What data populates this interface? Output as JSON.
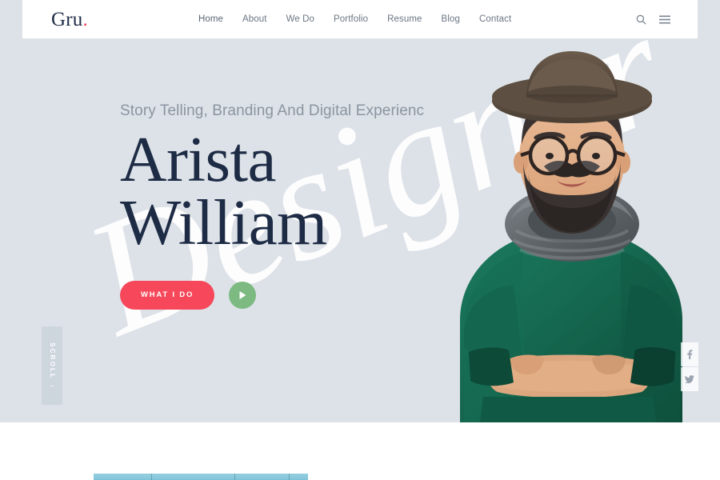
{
  "site": {
    "logo_text": "Gru",
    "logo_dot": ".",
    "accent_red": "#f6485a",
    "accent_green": "#7cba82",
    "text_dark": "#1d2b45",
    "page_bg": "#dde2e8"
  },
  "header": {
    "nav": [
      {
        "label": "Home"
      },
      {
        "label": "About"
      },
      {
        "label": "We Do"
      },
      {
        "label": "Portfolio"
      },
      {
        "label": "Resume"
      },
      {
        "label": "Blog"
      },
      {
        "label": "Contact"
      }
    ],
    "icons": [
      {
        "name": "search-icon"
      },
      {
        "name": "hamburger-menu-icon"
      }
    ]
  },
  "hero": {
    "watermark": "Designer",
    "subtitle": "Story Telling, Branding And Digital Experienc",
    "title_line1": "Arista",
    "title_line2": "William",
    "cta_label": "WHAT I DO",
    "play_label": "",
    "scroll_label": "SCROLL",
    "scroll_arrow": "↓",
    "photo_alt": "portrait-of-bearded-man-with-hat-and-glasses"
  },
  "social": [
    {
      "name": "facebook-icon",
      "label": "f"
    },
    {
      "name": "twitter-icon",
      "label": ""
    }
  ]
}
